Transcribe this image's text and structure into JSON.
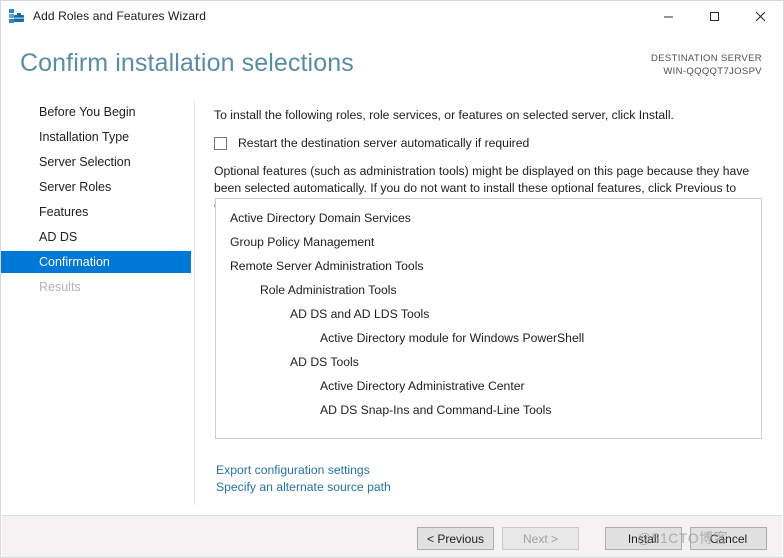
{
  "window": {
    "title": "Add Roles and Features Wizard",
    "icon": "server-wizard-icon",
    "controls": {
      "minimize": "minimize-icon",
      "maximize": "maximize-icon",
      "close": "close-icon"
    }
  },
  "header": {
    "page_title": "Confirm installation selections",
    "destination_label": "DESTINATION SERVER",
    "destination_server": "WIN-QQQQT7JOSPV"
  },
  "sidebar": {
    "items": [
      {
        "label": "Before You Begin",
        "state": "normal"
      },
      {
        "label": "Installation Type",
        "state": "normal"
      },
      {
        "label": "Server Selection",
        "state": "normal"
      },
      {
        "label": "Server Roles",
        "state": "normal"
      },
      {
        "label": "Features",
        "state": "normal"
      },
      {
        "label": "AD DS",
        "state": "normal"
      },
      {
        "label": "Confirmation",
        "state": "selected"
      },
      {
        "label": "Results",
        "state": "disabled"
      }
    ]
  },
  "main": {
    "intro": "To install the following roles, role services, or features on selected server, click Install.",
    "restart_checkbox": {
      "label": "Restart the destination server automatically if required",
      "checked": false
    },
    "optional_note": "Optional features (such as administration tools) might be displayed on this page because they have been selected automatically. If you do not want to install these optional features, click Previous to clear their check boxes.",
    "selections": [
      {
        "label": "Active Directory Domain Services",
        "level": 0
      },
      {
        "label": "Group Policy Management",
        "level": 0
      },
      {
        "label": "Remote Server Administration Tools",
        "level": 0
      },
      {
        "label": "Role Administration Tools",
        "level": 1
      },
      {
        "label": "AD DS and AD LDS Tools",
        "level": 2
      },
      {
        "label": "Active Directory module for Windows PowerShell",
        "level": 3
      },
      {
        "label": "AD DS Tools",
        "level": 2
      },
      {
        "label": "Active Directory Administrative Center",
        "level": 3
      },
      {
        "label": "AD DS Snap-Ins and Command-Line Tools",
        "level": 3
      }
    ],
    "links": [
      "Export configuration settings",
      "Specify an alternate source path"
    ]
  },
  "footer": {
    "previous": "< Previous",
    "next": "Next >",
    "install": "Install",
    "cancel": "Cancel",
    "next_disabled": true
  },
  "watermark": "@51CTO博客",
  "colors": {
    "accent": "#0078d7",
    "title_blue": "#5a8ca5",
    "link": "#2573a7",
    "footer_bg": "#f4f2f2"
  }
}
